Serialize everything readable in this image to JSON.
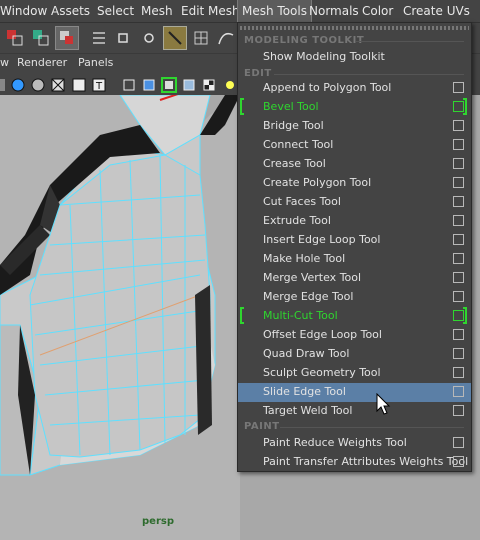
{
  "menubar": {
    "items": [
      "Window",
      "Assets",
      "Select",
      "Mesh",
      "Edit Mesh",
      "Mesh Tools",
      "Normals",
      "Color",
      "Create UVs"
    ],
    "active": "Mesh Tools"
  },
  "panel_menu": {
    "items": [
      "w",
      "Renderer",
      "Panels"
    ]
  },
  "viewport": {
    "camera_label": "persp"
  },
  "mesh_tools_menu": {
    "sections": {
      "modeling_toolkit": "MODELING TOOLKIT",
      "edit": "EDIT",
      "paint": "PAINT"
    },
    "show_modeling_toolkit": "Show Modeling Toolkit",
    "edit_items": [
      {
        "label": "Append to Polygon Tool"
      },
      {
        "label": "Bevel Tool",
        "highlight_green": true
      },
      {
        "label": "Bridge Tool"
      },
      {
        "label": "Connect Tool"
      },
      {
        "label": "Crease Tool"
      },
      {
        "label": "Create Polygon Tool"
      },
      {
        "label": "Cut Faces Tool"
      },
      {
        "label": "Extrude Tool"
      },
      {
        "label": "Insert Edge Loop Tool"
      },
      {
        "label": "Make Hole Tool"
      },
      {
        "label": "Merge Vertex Tool"
      },
      {
        "label": "Merge Edge Tool"
      },
      {
        "label": "Multi-Cut Tool",
        "highlight_green": true
      },
      {
        "label": "Offset Edge Loop Tool"
      },
      {
        "label": "Quad Draw Tool"
      },
      {
        "label": "Sculpt Geometry Tool"
      },
      {
        "label": "Slide Edge Tool",
        "hovered": true
      },
      {
        "label": "Target Weld Tool"
      }
    ],
    "paint_items": [
      {
        "label": "Paint Reduce Weights Tool"
      },
      {
        "label": "Paint Transfer Attributes Weights Tool"
      }
    ]
  },
  "colors": {
    "background": "#444444",
    "highlight": "#5b7fa6",
    "green_accent": "#2fd62f",
    "wireframe": "#5fe0ff"
  }
}
